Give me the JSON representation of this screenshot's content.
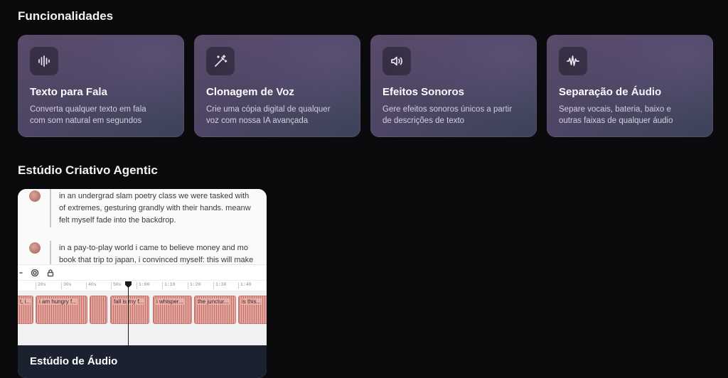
{
  "sections": {
    "features_title": "Funcionalidades",
    "studio_title": "Estúdio Criativo Agentic"
  },
  "cards": [
    {
      "icon": "waveform-icon",
      "title": "Texto para Fala",
      "desc_1": "Converta qualquer texto em fala",
      "desc_2": "com som natural em segundos"
    },
    {
      "icon": "magic-wand-icon",
      "title": "Clonagem de Voz",
      "desc_1": "Crie uma cópia digital de qualquer",
      "desc_2": "voz com nossa IA avançada"
    },
    {
      "icon": "speaker-icon",
      "title": "Efeitos Sonoros",
      "desc_1": "Gere efeitos sonoros únicos a partir",
      "desc_2": "de descrições de texto"
    },
    {
      "icon": "audio-wave-icon",
      "title": "Separação de Áudio",
      "desc_1": "Separe vocais, bateria, baixo e",
      "desc_2": "outras faixas de qualquer áudio"
    }
  ],
  "studio": {
    "footer_label": "Estúdio de Áudio",
    "transcript": [
      {
        "line_1": "in an undergrad slam poetry class we were tasked with",
        "line_2": "of extremes, gesturing grandly with their hands. meanw",
        "line_3": "felt myself fade into the backdrop."
      },
      {
        "line_1": "in a pay-to-play world i came to believe money and mo",
        "line_2": "book that trip to japan, i convinced myself: this will make"
      }
    ],
    "ruler_ticks": [
      "20s",
      "30s",
      "40s",
      "50s",
      "1:00",
      "1:10",
      "1:20",
      "1:30",
      "1:40"
    ],
    "clips": [
      "t, i...",
      "i am hungry f...",
      "fall is my f...",
      "i whisper...",
      "the junctur...",
      "is this..."
    ]
  }
}
